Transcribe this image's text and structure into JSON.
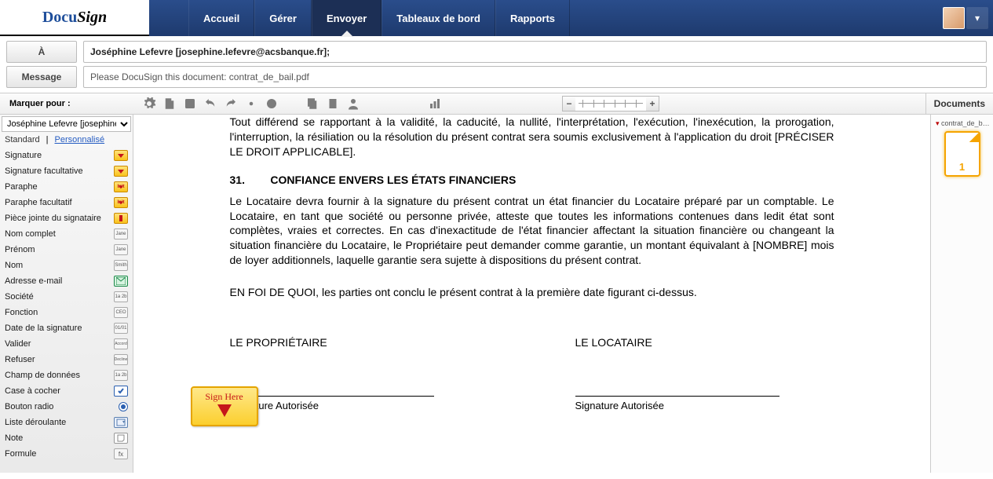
{
  "brand": {
    "part1": "Docu",
    "part2": "Sign"
  },
  "nav": {
    "items": [
      "Accueil",
      "Gérer",
      "Envoyer",
      "Tableaux de bord",
      "Rapports"
    ],
    "active_index": 2
  },
  "compose": {
    "to_button": "À",
    "to_value": "Joséphine Lefevre [josephine.lefevre@acsbanque.fr];",
    "message_button": "Message",
    "subject_value": "Please DocuSign this document: contrat_de_bail.pdf"
  },
  "toolbar": {
    "marquer_label": "Marquer pour :",
    "documents_label": "Documents"
  },
  "left": {
    "recipient_selected": "Joséphine Lefevre [josephine.lefevre@acsbanque.fr]",
    "tab_standard": "Standard",
    "tab_personnalise": "Personnalisé",
    "fields": [
      {
        "label": "Signature",
        "badge": "yellow-arrow"
      },
      {
        "label": "Signature facultative",
        "badge": "yellow-arrow"
      },
      {
        "label": "Paraphe",
        "badge": "yellow-initial"
      },
      {
        "label": "Paraphe facultatif",
        "badge": "yellow-initial"
      },
      {
        "label": "Pièce jointe du signataire",
        "badge": "yellow-attach"
      },
      {
        "label": "Nom complet",
        "badge": "gray",
        "badge_text": "Jane"
      },
      {
        "label": "Prénom",
        "badge": "gray",
        "badge_text": "Jane"
      },
      {
        "label": "Nom",
        "badge": "gray",
        "badge_text": "Smith"
      },
      {
        "label": "Adresse e-mail",
        "badge": "mail"
      },
      {
        "label": "Société",
        "badge": "gray",
        "badge_text": "1a 2b"
      },
      {
        "label": "Fonction",
        "badge": "gray",
        "badge_text": "CEO"
      },
      {
        "label": "Date de la signature",
        "badge": "gray",
        "badge_text": "01/01"
      },
      {
        "label": "Valider",
        "badge": "gray-btn",
        "badge_text": "Accord"
      },
      {
        "label": "Refuser",
        "badge": "gray-btn",
        "badge_text": "Decline"
      },
      {
        "label": "Champ de données",
        "badge": "gray",
        "badge_text": "1a 2b"
      },
      {
        "label": "Case à cocher",
        "badge": "checkbox"
      },
      {
        "label": "Bouton radio",
        "badge": "radio"
      },
      {
        "label": "Liste déroulante",
        "badge": "dropdown"
      },
      {
        "label": "Note",
        "badge": "note"
      },
      {
        "label": "Formule",
        "badge": "formula"
      }
    ]
  },
  "document": {
    "para_top": "Tout différend se rapportant à la validité, la caducité, la nullité, l'interprétation, l'exécution, l'inexécution, la prorogation, l'interruption, la résiliation ou la résolution du présent contrat sera soumis exclusivement à l'application du droit [PRÉCISER LE DROIT APPLICABLE].",
    "section_num": "31.",
    "section_title": "CONFIANCE ENVERS LES ÉTATS FINANCIERS",
    "section_body": "Le Locataire devra fournir à la signature du présent contrat un état financier du Locataire préparé par un comptable. Le Locataire, en tant que société ou personne privée, atteste que toutes les informations contenues dans ledit état sont complètes, vraies et correctes. En cas d'inexactitude de l'état financier affectant la situation financière ou changeant la situation financière du Locataire, le Propriétaire peut demander comme garantie, un montant équivalant à [NOMBRE] mois de loyer additionnels, laquelle garantie sera sujette à dispositions du présent contrat.",
    "witness": "EN FOI DE QUOI, les parties ont conclu le présent contrat à la première date figurant ci-dessus.",
    "sig_left_title": "LE PROPRIÉTAIRE",
    "sig_right_title": "LE LOCATAIRE",
    "sig_line_label": "Signature Autorisée",
    "sign_here_label": "Sign Here"
  },
  "right": {
    "doc_name": "contrat_de_b…",
    "page_number": "1"
  }
}
